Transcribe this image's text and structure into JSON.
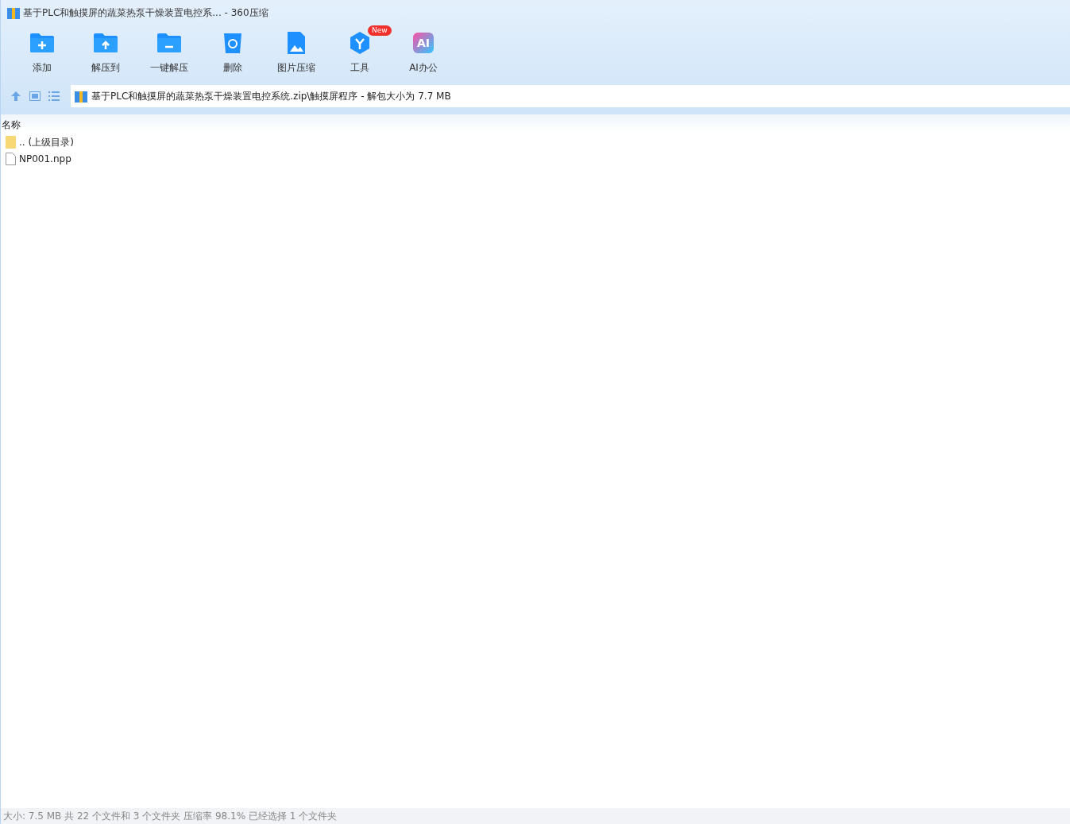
{
  "window": {
    "title": "基于PLC和触摸屏的蔬菜热泵干燥装置电控系... - 360压缩"
  },
  "toolbar": [
    {
      "kind": "add",
      "label": "添加"
    },
    {
      "kind": "extract",
      "label": "解压到"
    },
    {
      "kind": "oneclick",
      "label": "一键解压"
    },
    {
      "kind": "delete",
      "label": "删除"
    },
    {
      "kind": "image",
      "label": "图片压缩"
    },
    {
      "kind": "tools",
      "label": "工具",
      "badge": "New"
    },
    {
      "kind": "ai",
      "label": "AI办公",
      "icon_text": "AI"
    }
  ],
  "path": "基于PLC和触摸屏的蔬菜热泵干燥装置电控系统.zip\\触摸屏程序 - 解包大小为 7.7 MB",
  "columns": [
    "名称"
  ],
  "files": [
    {
      "kind": "folder",
      "name": ".. (上级目录)"
    },
    {
      "kind": "file",
      "name": "NP001.npp"
    }
  ],
  "status_bar": "大小: 7.5 MB 共 22 个文件和 3 个文件夹 压缩率 98.1% 已经选择 1 个文件夹"
}
